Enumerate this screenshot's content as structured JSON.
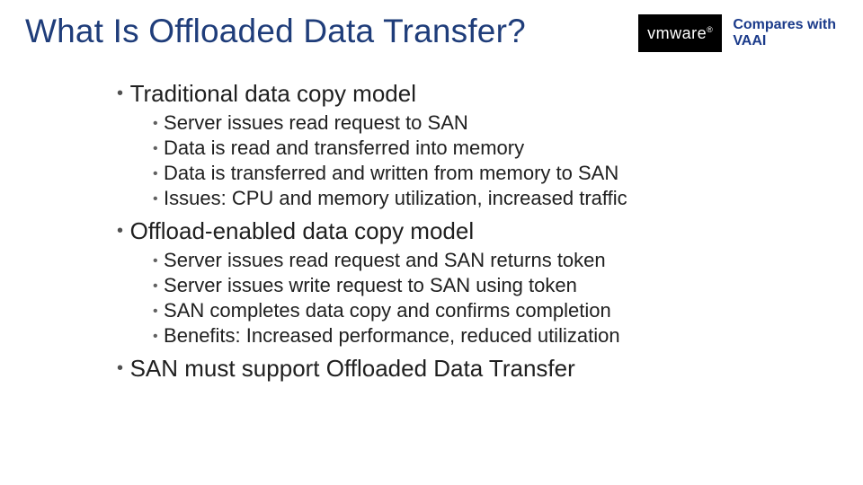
{
  "title": "What Is Offloaded Data Transfer?",
  "badge": {
    "logo_text": "vmware",
    "line1": "Compares with",
    "line2": "VAAI"
  },
  "bullets": [
    {
      "text": "Traditional data copy model",
      "children": [
        "Server issues read request to SAN",
        "Data is read and transferred into memory",
        "Data is transferred and written from memory to SAN",
        "Issues: CPU and memory utilization, increased traffic"
      ]
    },
    {
      "text": "Offload-enabled data copy model",
      "children": [
        "Server issues read request and SAN returns token",
        "Server issues write request to SAN using token",
        "SAN completes data copy and confirms completion",
        "Benefits: Increased performance, reduced utilization"
      ]
    },
    {
      "text": "SAN must support Offloaded Data Transfer",
      "children": []
    }
  ]
}
